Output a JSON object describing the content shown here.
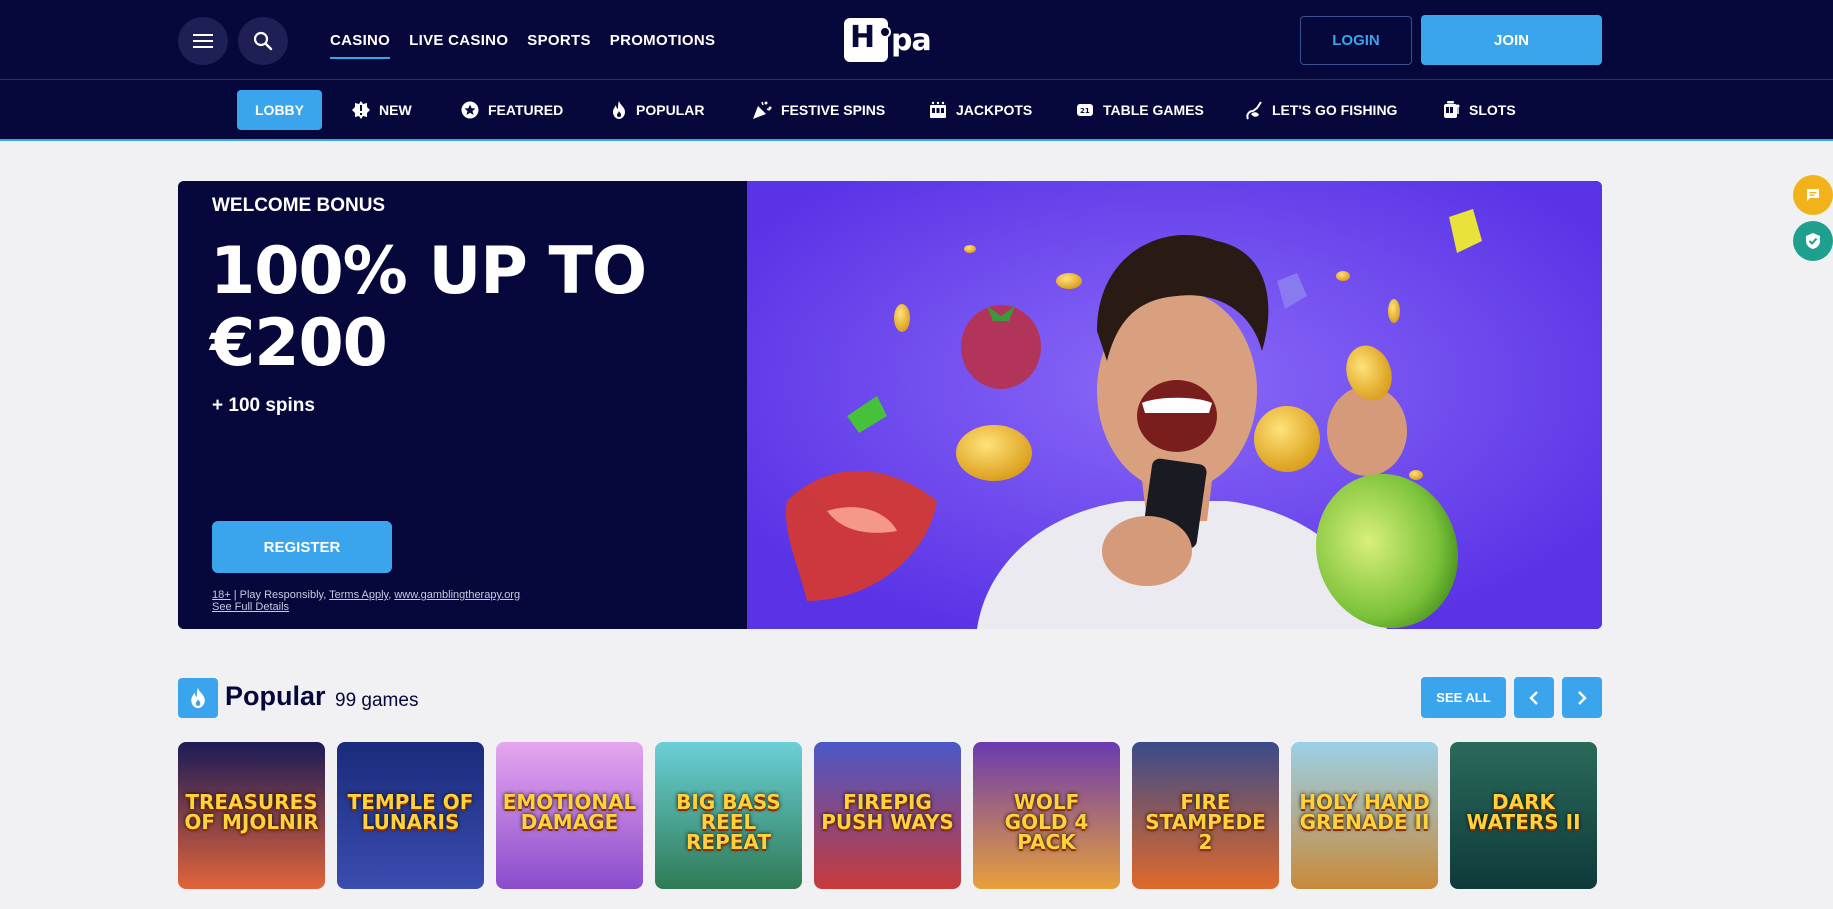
{
  "header": {
    "nav": [
      "CASINO",
      "LIVE CASINO",
      "SPORTS",
      "PROMOTIONS"
    ],
    "logo_text": "Hopa",
    "login_label": "LOGIN",
    "join_label": "JOIN"
  },
  "categories": [
    {
      "label": "LOBBY",
      "icon": "none"
    },
    {
      "label": "NEW",
      "icon": "new-icon"
    },
    {
      "label": "FEATURED",
      "icon": "star-icon"
    },
    {
      "label": "POPULAR",
      "icon": "flame-icon"
    },
    {
      "label": "FESTIVE SPINS",
      "icon": "party-icon"
    },
    {
      "label": "JACKPOTS",
      "icon": "jackpot-icon"
    },
    {
      "label": "TABLE GAMES",
      "icon": "cards-icon"
    },
    {
      "label": "LET'S GO FISHING",
      "icon": "fish-icon"
    },
    {
      "label": "SLOTS",
      "icon": "slot-icon"
    }
  ],
  "hero": {
    "eyebrow": "WELCOME BONUS",
    "title": "100% UP TO €200",
    "subtitle": "+ 100 spins",
    "cta": "REGISTER",
    "legal": {
      "age": "18+",
      "text": " | Play Responsibly, ",
      "terms": "Terms Apply",
      "comma": ", ",
      "site": "www.gamblingtherapy.org",
      "details": "See Full Details"
    }
  },
  "popular": {
    "title": "Popular",
    "count": "99 games",
    "see_all": "SEE ALL",
    "games": [
      {
        "name": "TREASURES OF MJOLNIR",
        "bg1": "#1a1b58",
        "bg2": "#e2643a"
      },
      {
        "name": "TEMPLE OF LUNARIS",
        "bg1": "#1a2b7a",
        "bg2": "#3a4db0"
      },
      {
        "name": "EMOTIONAL DAMAGE",
        "bg1": "#e6a6f0",
        "bg2": "#8a4ccc"
      },
      {
        "name": "BIG BASS REEL REPEAT",
        "bg1": "#6ad0d8",
        "bg2": "#2f7a54"
      },
      {
        "name": "FIREPIG PUSH WAYS",
        "bg1": "#4a58c8",
        "bg2": "#c83a3a"
      },
      {
        "name": "WOLF GOLD 4 PACK",
        "bg1": "#6a3ab0",
        "bg2": "#e8a03a"
      },
      {
        "name": "FIRE STAMPEDE 2",
        "bg1": "#3a4a8a",
        "bg2": "#e06a2a"
      },
      {
        "name": "HOLY HAND GRENADE II",
        "bg1": "#9ad0e8",
        "bg2": "#c88a3a"
      },
      {
        "name": "DARK WATERS II",
        "bg1": "#2a6a5a",
        "bg2": "#0e3a3a"
      }
    ]
  }
}
